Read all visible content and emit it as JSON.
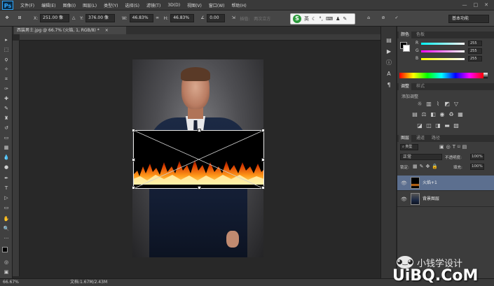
{
  "app": {
    "logo": "Ps"
  },
  "menu": [
    "文件(F)",
    "编辑(E)",
    "图像(I)",
    "图层(L)",
    "类型(Y)",
    "选择(S)",
    "滤镜(T)",
    "3D(D)",
    "视图(V)",
    "窗口(W)",
    "帮助(H)"
  ],
  "window_controls": [
    "—",
    "□",
    "✕"
  ],
  "options": {
    "x_label": "X:",
    "x_value": "251.00 像",
    "y_label": "Y:",
    "y_value": "376.00 像",
    "w_label": "W:",
    "w_value": "46.83%",
    "h_label": "H:",
    "h_value": "46.83%",
    "angle_value": "0.00",
    "interp_label": "插值:",
    "interp_value": "两次立方",
    "ime_letter": "S",
    "ime_mode": "英",
    "workspace": "基本功能"
  },
  "document": {
    "tab_title": "西装男士.jpg @ 66.7% (火焰, 1, RGB/8) *",
    "close": "×"
  },
  "status": {
    "zoom": "66.67%",
    "doc_info": "文档:1.67M/2.43M"
  },
  "panels": {
    "color_tabs": [
      "颜色",
      "色板"
    ],
    "color_values": [
      "255",
      "255",
      "255"
    ],
    "adjust_tabs": [
      "调整",
      "样式"
    ],
    "adjust_title": "添加调整",
    "layer_tabs": [
      "图层",
      "通道",
      "路径"
    ],
    "blend_mode": "正常",
    "opacity_label": "不透明度:",
    "opacity_value": "100%",
    "lock_label": "锁定:",
    "fill_label": "填充:",
    "fill_value": "100%",
    "layers": [
      {
        "name": "火焰+1",
        "selected": true
      },
      {
        "name": "背景图层",
        "selected": false
      }
    ]
  },
  "watermark": {
    "line1": "小钱学设计",
    "line2": "UiBQ.CoM"
  },
  "colors": {
    "accent": "#31a8ff",
    "selection": "#5c6f8f"
  }
}
